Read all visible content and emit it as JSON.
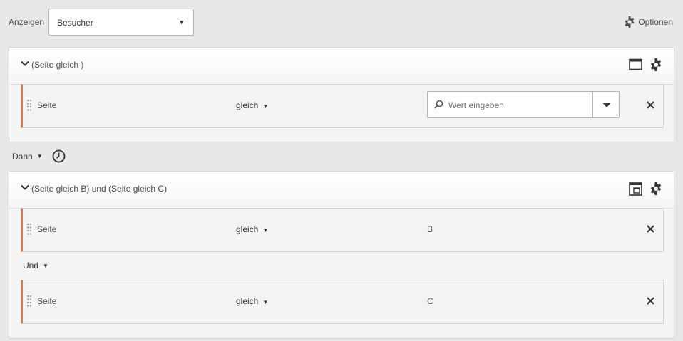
{
  "topbar": {
    "show_label": "Anzeigen",
    "show_select_value": "Besucher",
    "options_label": "Optionen"
  },
  "container1": {
    "title": "(Seite gleich )",
    "rules": [
      {
        "dimension": "Seite",
        "operator": "gleich",
        "value_placeholder": "Wert eingeben"
      }
    ]
  },
  "then_connector": {
    "label": "Dann"
  },
  "container2": {
    "title": "(Seite gleich B) und (Seite gleich C)",
    "rules": [
      {
        "dimension": "Seite",
        "operator": "gleich",
        "value": "B"
      },
      {
        "dimension": "Seite",
        "operator": "gleich",
        "value": "C"
      }
    ],
    "and_connector": "Und"
  },
  "colors": {
    "accent": "#e8743b",
    "background": "#e8e8e8",
    "panel": "#f4f4f4"
  }
}
